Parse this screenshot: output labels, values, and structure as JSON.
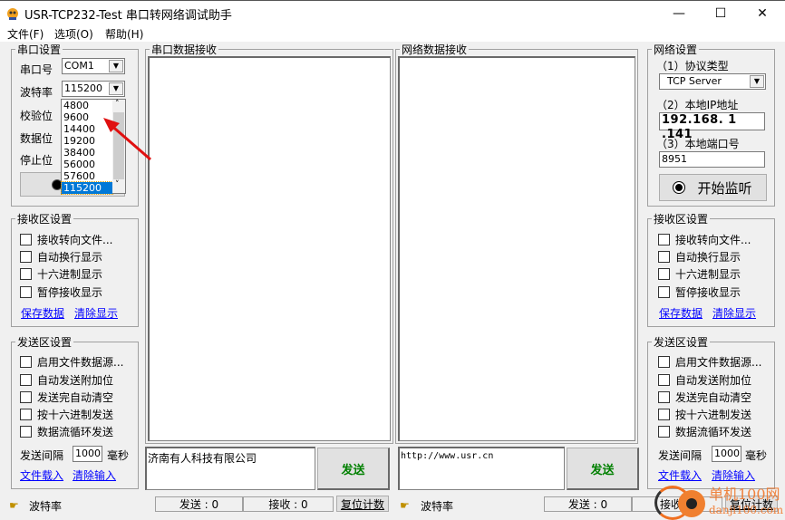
{
  "window": {
    "title": "USR-TCP232-Test 串口转网络调试助手",
    "minimize": "—",
    "maximize": "☐",
    "close": "✕"
  },
  "menu": [
    "文件(F)",
    "选项(O)",
    "帮助(H)"
  ],
  "serial_settings": {
    "title": "串口设置",
    "port_label": "串口号",
    "port_value": "COM1",
    "baud_label": "波特率",
    "baud_value": "115200",
    "parity_label": "校验位",
    "databits_label": "数据位",
    "stopbits_label": "停止位",
    "baud_options": [
      "4800",
      "9600",
      "14400",
      "19200",
      "38400",
      "56000",
      "57600",
      "115200"
    ],
    "baud_selected": "115200"
  },
  "left_recv_settings": {
    "title": "接收区设置",
    "options": [
      "接收转向文件...",
      "自动换行显示",
      "十六进制显示",
      "暂停接收显示"
    ],
    "save_link": "保存数据",
    "clear_link": "清除显示"
  },
  "left_send_settings": {
    "title": "发送区设置",
    "options": [
      "启用文件数据源...",
      "自动发送附加位",
      "发送完自动清空",
      "按十六进制发送",
      "数据流循环发送"
    ],
    "interval_label": "发送间隔",
    "interval_value": "1000",
    "interval_unit": "毫秒",
    "load_link": "文件载入",
    "clear_link": "清除输入"
  },
  "serial_recv": {
    "title": "串口数据接收"
  },
  "net_recv": {
    "title": "网络数据接收"
  },
  "serial_send": {
    "text": "济南有人科技有限公司",
    "send_label": "发送"
  },
  "net_send": {
    "text": "http://www.usr.cn",
    "send_label": "发送"
  },
  "net_settings": {
    "title": "网络设置",
    "protocol_label": "（1）协议类型",
    "protocol_value": "TCP Server",
    "ip_label": "（2）本地IP地址",
    "ip_value": "192.168. 1 .141",
    "port_label": "（3）本地端口号",
    "port_value": "8951",
    "listen_label": "开始监听"
  },
  "right_recv_settings": {
    "title": "接收区设置",
    "options": [
      "接收转向文件...",
      "自动换行显示",
      "十六进制显示",
      "暂停接收显示"
    ],
    "save_link": "保存数据",
    "clear_link": "清除显示"
  },
  "right_send_settings": {
    "title": "发送区设置",
    "options": [
      "启用文件数据源...",
      "自动发送附加位",
      "发送完自动清空",
      "按十六进制发送",
      "数据流循环发送"
    ],
    "interval_label": "发送间隔",
    "interval_value": "1000",
    "interval_unit": "毫秒",
    "load_link": "文件载入",
    "clear_link": "清除输入"
  },
  "status_left": {
    "hint": "波特率",
    "sent": "发送 : 0",
    "received": "接收 : 0",
    "reset": "复位计数"
  },
  "status_right": {
    "hint": "波特率",
    "sent": "发送 : 0",
    "received": "接收",
    "reset": "复位计数"
  },
  "watermark": {
    "text": "单机100网",
    "url_text": "danji100.com"
  }
}
